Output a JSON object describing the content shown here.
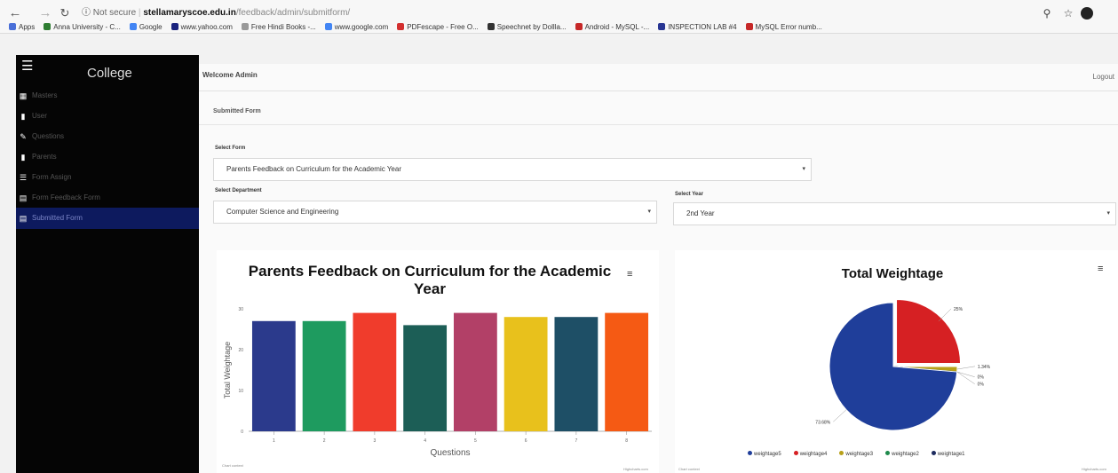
{
  "browser": {
    "not_secure": "Not secure",
    "host": "stellamaryscoe.edu.in",
    "path": "/feedback/admin/submitform/",
    "bookmarks": [
      {
        "label": "Apps",
        "color": "#4a6fd8"
      },
      {
        "label": "Anna University - C...",
        "color": "#2e7d32"
      },
      {
        "label": "Google",
        "color": "#4285f4"
      },
      {
        "label": "www.yahoo.com",
        "color": "#1a237e"
      },
      {
        "label": "Free Hindi Books -...",
        "color": "#999999"
      },
      {
        "label": "www.google.com",
        "color": "#4285f4"
      },
      {
        "label": "PDFescape - Free O...",
        "color": "#d32f2f"
      },
      {
        "label": "Speechnet by Dollla...",
        "color": "#333333"
      },
      {
        "label": "Android - MySQL -...",
        "color": "#c62828"
      },
      {
        "label": "INSPECTION LAB #4",
        "color": "#283593"
      },
      {
        "label": "MySQL Error numb...",
        "color": "#c62828"
      }
    ]
  },
  "sidebar": {
    "title": "College",
    "items": [
      {
        "label": "Masters",
        "icon": "grid-icon"
      },
      {
        "label": "User",
        "icon": "user-icon"
      },
      {
        "label": "Questions",
        "icon": "pencil-icon"
      },
      {
        "label": "Parents",
        "icon": "person-icon"
      },
      {
        "label": "Form Assign",
        "icon": "list-icon"
      },
      {
        "label": "Form Feedback Form",
        "icon": "form-icon"
      },
      {
        "label": "Submitted Form",
        "icon": "document-icon",
        "active": true
      }
    ]
  },
  "main": {
    "welcome": "Welcome Admin",
    "logout": "Logout",
    "section_title": "Submitted Form",
    "select_form_label": "Select Form",
    "select_form_value": "Parents Feedback on Curriculum for the Academic Year",
    "select_department_label": "Select Department",
    "select_department_value": "Computer Science and Engineering",
    "select_year_label": "Select Year",
    "select_year_value": "2nd Year"
  },
  "charts": {
    "bar_credits": "Highcharts.com",
    "pie_credits": "Highcharts.com",
    "bar_export": "Chart context",
    "pie_export": "Chart context"
  },
  "chart_data": [
    {
      "type": "bar",
      "title": "Parents Feedback on Curriculum for the Academic Year",
      "xlabel": "Questions",
      "ylabel": "Total Weightage",
      "categories": [
        "1",
        "2",
        "3",
        "4",
        "5",
        "6",
        "7",
        "8"
      ],
      "values": [
        27,
        27,
        29,
        26,
        29,
        28,
        28,
        29
      ],
      "colors": [
        "#2b3a8c",
        "#1e9b5f",
        "#f03c2c",
        "#1c5e56",
        "#b24067",
        "#e8c11c",
        "#1e4f66",
        "#f55a14"
      ],
      "yticks": [
        0,
        10,
        20,
        30
      ],
      "ylim": [
        0,
        30
      ],
      "grid": false,
      "legend": "none"
    },
    {
      "type": "pie",
      "title": "Total Weightage",
      "slices": [
        {
          "name": "weightage5",
          "label": "73.68%",
          "value": 73.68,
          "color": "#1f3e9a"
        },
        {
          "name": "weightage4",
          "label": "25%",
          "value": 25,
          "color": "#d62023"
        },
        {
          "name": "weightage3",
          "label": "1.34%",
          "value": 1.34,
          "color": "#b8a019"
        },
        {
          "name": "weightage2",
          "label": "0%",
          "value": 0,
          "color": "#1f8a4c"
        },
        {
          "name": "weightage1",
          "label": "0%",
          "value": 0,
          "color": "#1d2b5e"
        }
      ],
      "legend": "bottom"
    }
  ]
}
